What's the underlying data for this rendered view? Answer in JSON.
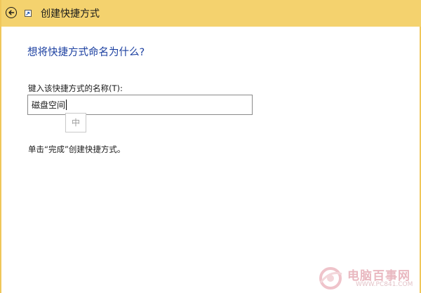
{
  "window": {
    "title": "创建快捷方式",
    "accent": "#f4d26e"
  },
  "page": {
    "heading": "想将快捷方式命名为什么?",
    "field_label": "键入该快捷方式的名称(T):",
    "field_value": "磁盘空间",
    "ime_indicator": "中",
    "hint": "单击“完成”创建快捷方式。"
  },
  "watermark": {
    "text": "电脑百事网",
    "url": "WWW.PC841.COM"
  },
  "icons": {
    "back": "back-arrow-icon",
    "app": "shortcut-icon"
  }
}
